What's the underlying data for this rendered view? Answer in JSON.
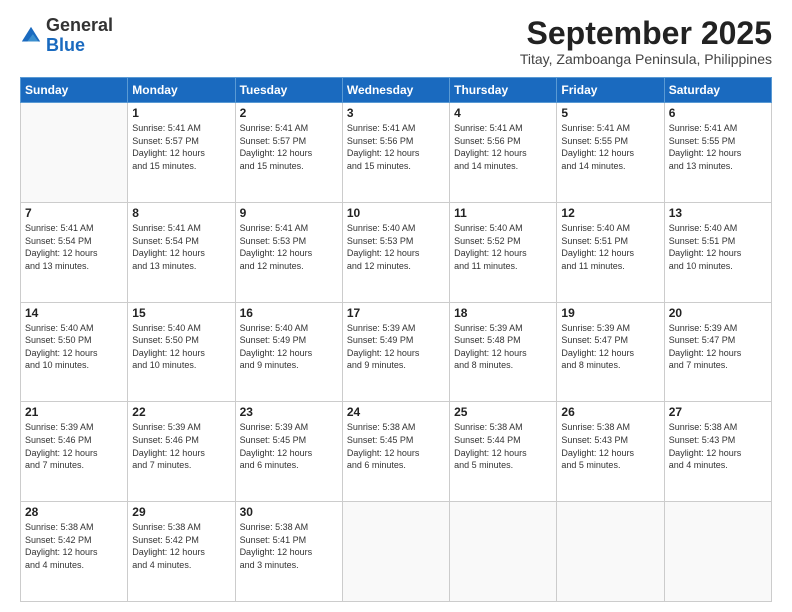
{
  "logo": {
    "general": "General",
    "blue": "Blue"
  },
  "header": {
    "month": "September 2025",
    "subtitle": "Titay, Zamboanga Peninsula, Philippines"
  },
  "days_of_week": [
    "Sunday",
    "Monday",
    "Tuesday",
    "Wednesday",
    "Thursday",
    "Friday",
    "Saturday"
  ],
  "weeks": [
    [
      {
        "day": "",
        "info": ""
      },
      {
        "day": "1",
        "info": "Sunrise: 5:41 AM\nSunset: 5:57 PM\nDaylight: 12 hours\nand 15 minutes."
      },
      {
        "day": "2",
        "info": "Sunrise: 5:41 AM\nSunset: 5:57 PM\nDaylight: 12 hours\nand 15 minutes."
      },
      {
        "day": "3",
        "info": "Sunrise: 5:41 AM\nSunset: 5:56 PM\nDaylight: 12 hours\nand 15 minutes."
      },
      {
        "day": "4",
        "info": "Sunrise: 5:41 AM\nSunset: 5:56 PM\nDaylight: 12 hours\nand 14 minutes."
      },
      {
        "day": "5",
        "info": "Sunrise: 5:41 AM\nSunset: 5:55 PM\nDaylight: 12 hours\nand 14 minutes."
      },
      {
        "day": "6",
        "info": "Sunrise: 5:41 AM\nSunset: 5:55 PM\nDaylight: 12 hours\nand 13 minutes."
      }
    ],
    [
      {
        "day": "7",
        "info": "Sunrise: 5:41 AM\nSunset: 5:54 PM\nDaylight: 12 hours\nand 13 minutes."
      },
      {
        "day": "8",
        "info": "Sunrise: 5:41 AM\nSunset: 5:54 PM\nDaylight: 12 hours\nand 13 minutes."
      },
      {
        "day": "9",
        "info": "Sunrise: 5:41 AM\nSunset: 5:53 PM\nDaylight: 12 hours\nand 12 minutes."
      },
      {
        "day": "10",
        "info": "Sunrise: 5:40 AM\nSunset: 5:53 PM\nDaylight: 12 hours\nand 12 minutes."
      },
      {
        "day": "11",
        "info": "Sunrise: 5:40 AM\nSunset: 5:52 PM\nDaylight: 12 hours\nand 11 minutes."
      },
      {
        "day": "12",
        "info": "Sunrise: 5:40 AM\nSunset: 5:51 PM\nDaylight: 12 hours\nand 11 minutes."
      },
      {
        "day": "13",
        "info": "Sunrise: 5:40 AM\nSunset: 5:51 PM\nDaylight: 12 hours\nand 10 minutes."
      }
    ],
    [
      {
        "day": "14",
        "info": "Sunrise: 5:40 AM\nSunset: 5:50 PM\nDaylight: 12 hours\nand 10 minutes."
      },
      {
        "day": "15",
        "info": "Sunrise: 5:40 AM\nSunset: 5:50 PM\nDaylight: 12 hours\nand 10 minutes."
      },
      {
        "day": "16",
        "info": "Sunrise: 5:40 AM\nSunset: 5:49 PM\nDaylight: 12 hours\nand 9 minutes."
      },
      {
        "day": "17",
        "info": "Sunrise: 5:39 AM\nSunset: 5:49 PM\nDaylight: 12 hours\nand 9 minutes."
      },
      {
        "day": "18",
        "info": "Sunrise: 5:39 AM\nSunset: 5:48 PM\nDaylight: 12 hours\nand 8 minutes."
      },
      {
        "day": "19",
        "info": "Sunrise: 5:39 AM\nSunset: 5:47 PM\nDaylight: 12 hours\nand 8 minutes."
      },
      {
        "day": "20",
        "info": "Sunrise: 5:39 AM\nSunset: 5:47 PM\nDaylight: 12 hours\nand 7 minutes."
      }
    ],
    [
      {
        "day": "21",
        "info": "Sunrise: 5:39 AM\nSunset: 5:46 PM\nDaylight: 12 hours\nand 7 minutes."
      },
      {
        "day": "22",
        "info": "Sunrise: 5:39 AM\nSunset: 5:46 PM\nDaylight: 12 hours\nand 7 minutes."
      },
      {
        "day": "23",
        "info": "Sunrise: 5:39 AM\nSunset: 5:45 PM\nDaylight: 12 hours\nand 6 minutes."
      },
      {
        "day": "24",
        "info": "Sunrise: 5:38 AM\nSunset: 5:45 PM\nDaylight: 12 hours\nand 6 minutes."
      },
      {
        "day": "25",
        "info": "Sunrise: 5:38 AM\nSunset: 5:44 PM\nDaylight: 12 hours\nand 5 minutes."
      },
      {
        "day": "26",
        "info": "Sunrise: 5:38 AM\nSunset: 5:43 PM\nDaylight: 12 hours\nand 5 minutes."
      },
      {
        "day": "27",
        "info": "Sunrise: 5:38 AM\nSunset: 5:43 PM\nDaylight: 12 hours\nand 4 minutes."
      }
    ],
    [
      {
        "day": "28",
        "info": "Sunrise: 5:38 AM\nSunset: 5:42 PM\nDaylight: 12 hours\nand 4 minutes."
      },
      {
        "day": "29",
        "info": "Sunrise: 5:38 AM\nSunset: 5:42 PM\nDaylight: 12 hours\nand 4 minutes."
      },
      {
        "day": "30",
        "info": "Sunrise: 5:38 AM\nSunset: 5:41 PM\nDaylight: 12 hours\nand 3 minutes."
      },
      {
        "day": "",
        "info": ""
      },
      {
        "day": "",
        "info": ""
      },
      {
        "day": "",
        "info": ""
      },
      {
        "day": "",
        "info": ""
      }
    ]
  ]
}
